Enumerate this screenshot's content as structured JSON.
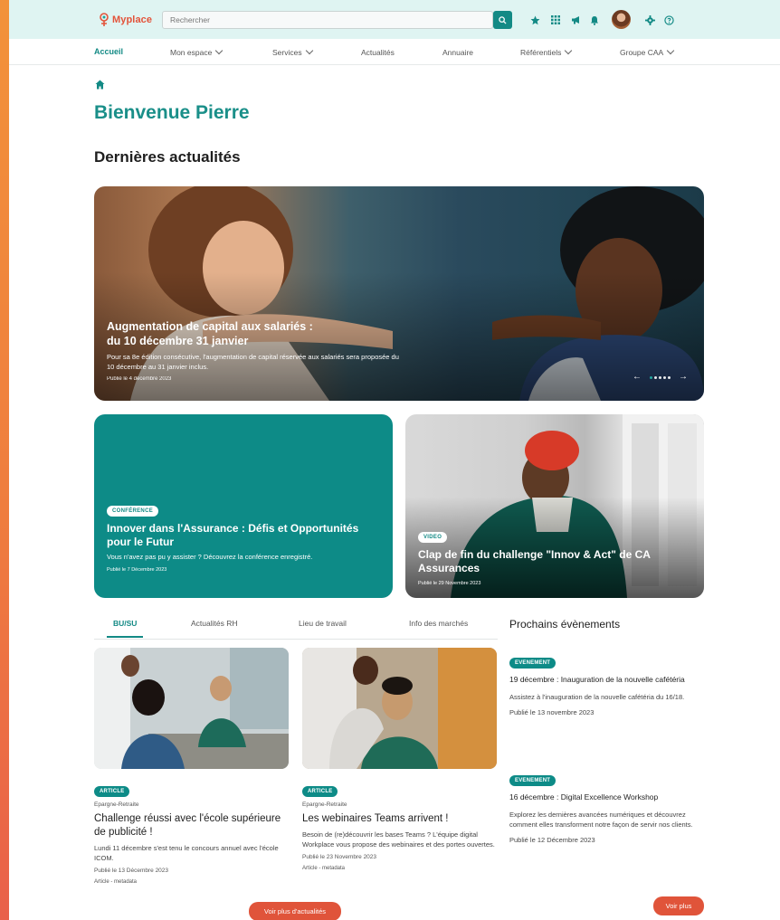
{
  "app": {
    "logo_text": "Myplace"
  },
  "search": {
    "placeholder": "Rechercher"
  },
  "toolbar_icons": [
    "star-icon",
    "grid-icon",
    "megaphone-icon",
    "bell-icon",
    "user-avatar",
    "gear-icon",
    "help-icon"
  ],
  "nav": {
    "items": [
      {
        "label": "Accueil",
        "active": true
      },
      {
        "label": "Mon espace",
        "dropdown": true
      },
      {
        "label": "Services",
        "dropdown": true
      },
      {
        "label": "Actualités"
      },
      {
        "label": "Annuaire"
      },
      {
        "label": "Référentiels",
        "dropdown": true
      },
      {
        "label": "Groupe CAA",
        "dropdown": true
      }
    ]
  },
  "page": {
    "welcome": "Bienvenue Pierre",
    "news_section_title": "Dernières actualités"
  },
  "hero": {
    "title_line1": "Augmentation de capital aux salariés :",
    "title_line2": "du 10 décembre 31 janvier",
    "description": "Pour sa 8e édition consécutive, l'augmentation de capital réservée aux salariés sera proposée du 10 décembre au 31 janvier inclus.",
    "date": "Publié le 4 décembre 2023",
    "slides_count": 5,
    "active_slide": 1
  },
  "cards": [
    {
      "tag": "CONFÉRENCE",
      "title": "Innover dans l'Assurance : Défis et Opportunités pour le Futur",
      "description": "Vous n'avez pas pu y assister ? Découvrez la conférence enregistré.",
      "date": "Publié le 7 Décembre 2023"
    },
    {
      "tag": "VIDEO",
      "title": "Clap de fin du challenge \"Innov & Act\" de CA Assurances",
      "date": "Publié le 29 Novembre 2023"
    }
  ],
  "tabs": [
    {
      "label": "BU/SU",
      "active": true
    },
    {
      "label": "Actualités RH"
    },
    {
      "label": "Lieu de travail"
    },
    {
      "label": "Info des marchés"
    }
  ],
  "articles": [
    {
      "tag": "ARTICLE",
      "category": "Epargne-Retraite",
      "title": "Challenge réussi avec l'école supérieure de publicité !",
      "description": "Lundi 11 décembre s'est tenu le concours annuel avec l'école ICOM.",
      "date": "Publié le 13 Décembre 2023",
      "meta": "Article - metadata"
    },
    {
      "tag": "ARTICLE",
      "category": "Epargne-Retraite",
      "title": "Les webinaires Teams arrivent !",
      "description": "Besoin de (re)découvrir les bases Teams ? L'équipe digital Workplace vous propose des webinaires et des portes ouvertes.",
      "date": "Publié le 23 Novembre 2023",
      "meta": "Article - metadata"
    }
  ],
  "events": {
    "title": "Prochains évènements",
    "items": [
      {
        "tag": "EVENEMENT",
        "title": "19 décembre : Inauguration de la nouvelle cafétéria",
        "description": "Assistez à l'inauguration de la nouvelle cafétéria du 16/18.",
        "date": "Publié le 13 novembre 2023"
      },
      {
        "tag": "EVENEMENT",
        "title": "16 décembre : Digital Excellence Workshop",
        "description": "Explorez les dernières avancées numériques et découvrez comment elles transforment notre façon de servir nos clients.",
        "date": "Publié le 12 Décembre 2023"
      }
    ],
    "more_label": "Voir plus"
  },
  "more_news_label": "Voir plus d'actualités",
  "colors": {
    "brand_teal": "#138a85",
    "accent_orange": "#e0543a",
    "logo_red": "#e3533a"
  }
}
